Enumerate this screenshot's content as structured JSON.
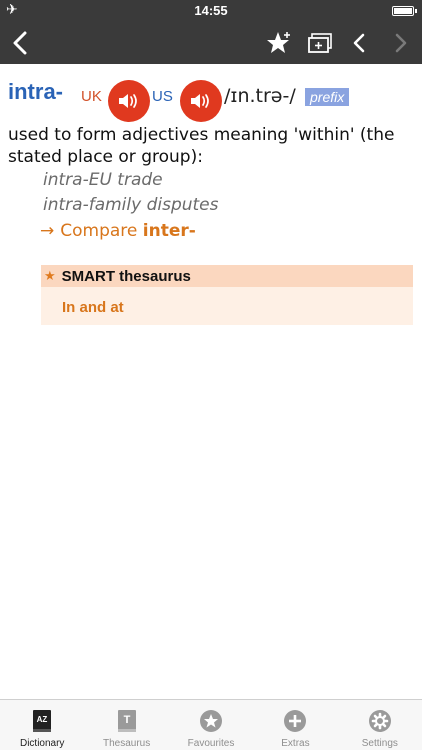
{
  "status": {
    "time": "14:55"
  },
  "entry": {
    "headword": "intra-",
    "uk_label": "UK",
    "us_label": "US",
    "pronunciation": "/ɪn.trə-/",
    "part_of_speech": "prefix",
    "definition": "used to form adjectives meaning 'within' (the stated place or group):",
    "examples": [
      "intra-EU trade",
      "intra-family disputes"
    ],
    "compare": {
      "arrow": "→",
      "label": "Compare",
      "ref": "inter-"
    }
  },
  "smart_thesaurus": {
    "title": "SMART thesaurus",
    "link": "In and at"
  },
  "tabs": [
    {
      "label": "Dictionary",
      "icon": "dictionary-az-icon",
      "active": true
    },
    {
      "label": "Thesaurus",
      "icon": "thesaurus-t-icon",
      "active": false
    },
    {
      "label": "Favourites",
      "icon": "favourites-star-icon",
      "active": false
    },
    {
      "label": "Extras",
      "icon": "extras-plus-icon",
      "active": false
    },
    {
      "label": "Settings",
      "icon": "settings-gear-icon",
      "active": false
    }
  ],
  "colors": {
    "headword": "#2a63b6",
    "speaker": "#e0391f",
    "accent": "#d8761c",
    "bar": "#3a3a3a"
  }
}
